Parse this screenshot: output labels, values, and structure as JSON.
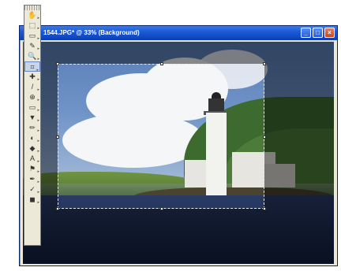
{
  "window": {
    "title": "1544.JPG* @ 33% (Background)",
    "buttons": {
      "minimize": "_",
      "maximize": "□",
      "close": "×"
    }
  },
  "toolbox": {
    "tools": [
      {
        "name": "hand-tool",
        "glyph": "✋"
      },
      {
        "name": "move-tool",
        "glyph": "⬚"
      },
      {
        "name": "marquee-tool",
        "glyph": "▭"
      },
      {
        "name": "magic-wand-tool",
        "glyph": "✎"
      },
      {
        "name": "zoom-tool",
        "glyph": "🔍"
      },
      {
        "name": "crop-tool",
        "glyph": "⌗"
      },
      {
        "name": "red-eye-tool",
        "glyph": "✚"
      },
      {
        "name": "brush-tool",
        "glyph": "/"
      },
      {
        "name": "clone-tool",
        "glyph": "⊕"
      },
      {
        "name": "eraser-tool",
        "glyph": "▭"
      },
      {
        "name": "fill-tool",
        "glyph": "▼"
      },
      {
        "name": "pencil-tool",
        "glyph": "✏"
      },
      {
        "name": "gradient-tool",
        "glyph": "◐"
      },
      {
        "name": "shape-tool",
        "glyph": "◆"
      },
      {
        "name": "text-tool",
        "glyph": "A"
      },
      {
        "name": "dodge-tool",
        "glyph": "⚑"
      },
      {
        "name": "pen-tool",
        "glyph": "✒"
      },
      {
        "name": "picker-tool",
        "glyph": "✓"
      },
      {
        "name": "color-tool",
        "glyph": "◼"
      }
    ],
    "active_tool": "crop-tool"
  }
}
